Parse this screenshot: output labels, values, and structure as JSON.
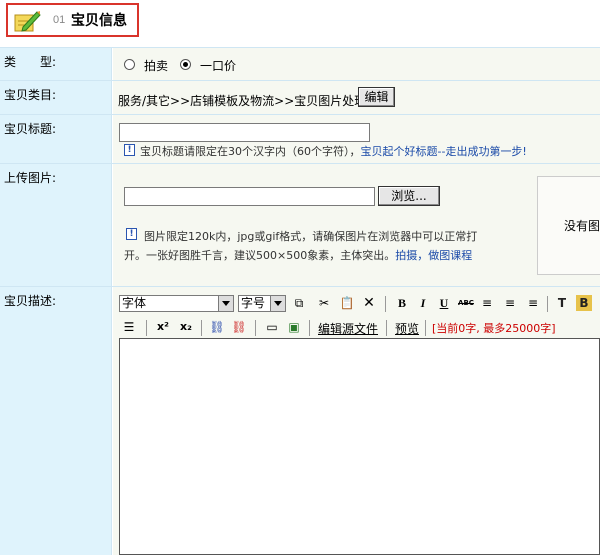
{
  "header": {
    "num": "01",
    "title": "宝贝信息"
  },
  "type_row": {
    "label": "类　　型:",
    "options": [
      "拍卖",
      "一口价"
    ],
    "selected": "一口价"
  },
  "category_row": {
    "label": "宝贝类目:",
    "path": "服务/其它>>店铺模板及物流>>宝贝图片处理",
    "edit_label": "编辑"
  },
  "title_row": {
    "label": "宝贝标题:",
    "value": "",
    "tip": "宝贝标题请限定在30个汉字内（60个字符），",
    "tip_link": "宝贝起个好标题--走出成功第一步!"
  },
  "upload_row": {
    "label": "上传图片:",
    "browse_label": "浏览...",
    "tip_line1": "图片限定120k内，jpg或gif格式，请确保图片在浏览器中可以正常打",
    "tip_line2": "开。一张好图胜千言，建议500×500象素，主体突出。",
    "tip_link": "拍摄，做图课程",
    "preview_text": "没有图"
  },
  "desc_row": {
    "label": "宝贝描述:",
    "font_select": "字体",
    "size_select": "字号",
    "toolbar": {
      "bold": "B",
      "italic": "I",
      "underline": "U",
      "strike": "ABC",
      "sup": "x²",
      "sub": "x₂",
      "source_label": "编辑源文件",
      "preview_label": "预览",
      "count_text": "[当前0字, 最多25000字]"
    }
  },
  "colors": {
    "label_bg": "#dff3fc",
    "value_bg": "#f6f8f1",
    "header_border": "#d9342b",
    "link": "#1a4aa8",
    "count_red": "#cc0000"
  }
}
